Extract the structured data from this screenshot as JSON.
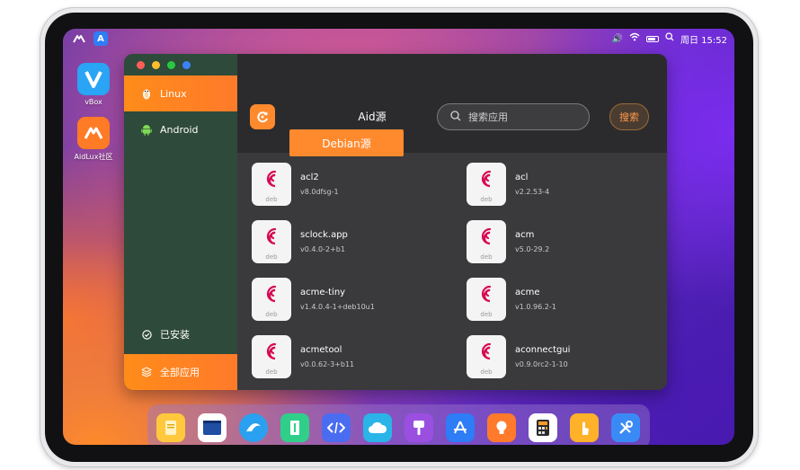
{
  "menubar": {
    "left_icons": [
      "aidlux-logo-icon",
      "app-store-icon"
    ],
    "status": {
      "sound": "🔊",
      "wifi": "wifi-icon",
      "battery": "battery-icon",
      "search": "search-icon",
      "clock": "周日 15:52"
    }
  },
  "desktop": {
    "icons": [
      {
        "label": "vBox",
        "icon": "vbox-icon"
      },
      {
        "label": "AidLux社区",
        "icon": "aidlux-community-icon"
      }
    ]
  },
  "window": {
    "traffic_colors": [
      "#ff5f57",
      "#febc2e",
      "#28c840",
      "#3b82f6"
    ],
    "sidebar": {
      "items": [
        {
          "label": "Linux",
          "icon": "linux-tux-icon",
          "active": true
        },
        {
          "label": "Android",
          "icon": "android-icon",
          "active": false
        }
      ],
      "bottom": [
        {
          "label": "已安装",
          "icon": "installed-icon",
          "active": false
        },
        {
          "label": "全部应用",
          "icon": "all-apps-icon",
          "active": true
        }
      ]
    },
    "header": {
      "tabs": [
        {
          "label": "Aid源",
          "active": false
        },
        {
          "label": "Debian源",
          "active": true
        }
      ],
      "search": {
        "placeholder": "搜索应用",
        "value": ""
      },
      "search_button": "搜索"
    },
    "packages": [
      {
        "name": "acl2",
        "version": "v8.0dfsg-1"
      },
      {
        "name": "acl",
        "version": "v2.2.53-4"
      },
      {
        "name": "sclock.app",
        "version": "v0.4.0-2+b1"
      },
      {
        "name": "acm",
        "version": "v5.0-29.2"
      },
      {
        "name": "acme-tiny",
        "version": "v1.4.0.4-1+deb10u1"
      },
      {
        "name": "acme",
        "version": "v1.0.96.2-1"
      },
      {
        "name": "acmetool",
        "version": "v0.0.62-3+b11"
      },
      {
        "name": "aconnectgui",
        "version": "v0.9.0rc2-1-10"
      }
    ],
    "package_badge": "deb"
  },
  "dock": {
    "items": [
      "files-icon",
      "terminal-icon",
      "browser-icon",
      "file-manager-icon",
      "code-editor-icon",
      "cloud-icon",
      "paint-icon",
      "app-store-icon",
      "tips-icon",
      "calculator-icon",
      "touch-icon",
      "settings-tools-icon"
    ]
  },
  "colors": {
    "accent": "#ff8a2e",
    "sidebar_bg": "#2e4a3a",
    "main_bg": "#3a3a3c"
  }
}
